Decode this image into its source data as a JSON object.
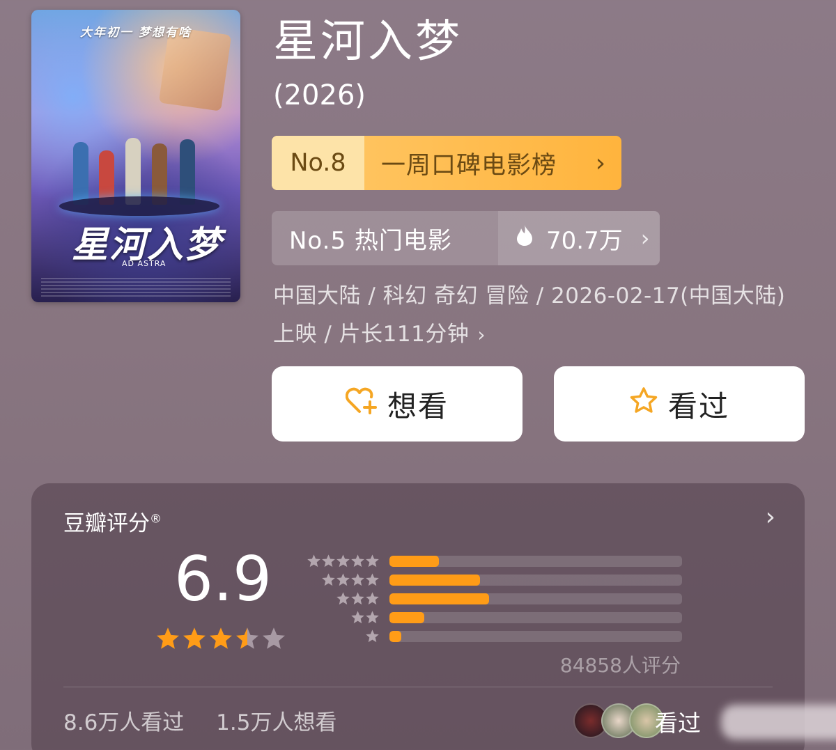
{
  "poster": {
    "tagline": "大年初一 梦想有啥",
    "title": "星河入梦",
    "english_title": "AD ASTRA"
  },
  "movie": {
    "title": "星河入梦",
    "year": "(2026)"
  },
  "rank_weekly": {
    "number": "No.8",
    "label": "一周口碑电影榜",
    "chevron": "›"
  },
  "rank_hot": {
    "label": "No.5 热门电影",
    "heat": "70.7万",
    "icon": "fire-icon",
    "chevron": "›"
  },
  "meta": {
    "line1": "中国大陆 / 科幻 奇幻 冒险 / 2026-02-17(中国大陆)",
    "line2": "上映 / 片长111分钟",
    "chevron": "›"
  },
  "buttons": {
    "want": "想看",
    "seen": "看过"
  },
  "rating": {
    "title": "豆瓣评分",
    "registered": "®",
    "arrow": "›",
    "score": "6.9",
    "stars": 3.5,
    "distribution": [
      {
        "stars": 5,
        "fraction": 0.17
      },
      {
        "stars": 4,
        "fraction": 0.31
      },
      {
        "stars": 3,
        "fraction": 0.34
      },
      {
        "stars": 2,
        "fraction": 0.12
      },
      {
        "stars": 1,
        "fraction": 0.04
      }
    ],
    "count": "84858人评分",
    "seen_count": "8.6万人看过",
    "want_count": "1.5万人想看",
    "friends_seen": "看过",
    "colors": {
      "bar": "#ff9c17",
      "star": "#ff9c17",
      "star_empty": "#a89aa4"
    }
  }
}
